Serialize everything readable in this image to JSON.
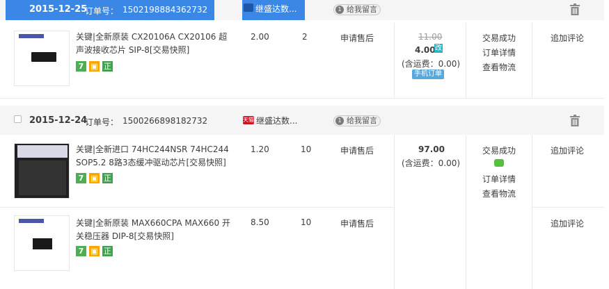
{
  "orders": [
    {
      "date": "2015-12-25",
      "order_label": "订单号：",
      "order_no": "1502198884362732",
      "shop": "继盛达数...",
      "message_btn": "给我留言",
      "items": [
        {
          "title": "关键|全新原装 CX20106A CX20106 超声波接收芯片 SIP-8[交易快照]",
          "unit_price": "2.00",
          "qty": "2",
          "after_sale": "申请售后",
          "review": "追加评论"
        }
      ],
      "original_total": "11.00",
      "total": "4.00",
      "changed_tag": "改",
      "shipping": "(含运费：0.00)",
      "mobile_tag": "手机订单",
      "status": "交易成功",
      "detail": "订单详情",
      "logistics": "查看物流"
    },
    {
      "date": "2015-12-24",
      "order_label": "订单号：",
      "order_no": "1500266898182732",
      "shop": "继盛达数...",
      "shop_tag": "天猫",
      "message_btn": "给我留言",
      "items": [
        {
          "title": "关键|全新进口 74HC244NSR 74HC244 SOP5.2 8路3态缓冲驱动芯片[交易快照]",
          "unit_price": "1.20",
          "qty": "10",
          "after_sale": "申请售后",
          "review": "追加评论"
        },
        {
          "title": "关键|全新原装 MAX660CPA MAX660 开关稳压器 DIP-8[交易快照]",
          "unit_price": "8.50",
          "qty": "10",
          "after_sale": "申请售后",
          "review": "追加评论"
        }
      ],
      "total": "97.00",
      "shipping": "(含运费：0.00)",
      "status": "交易成功",
      "detail": "订单详情",
      "logistics": "查看物流"
    }
  ],
  "badges": {
    "seven": "7",
    "zheng": "正"
  },
  "icons": {
    "trash": "trash-icon",
    "message_dot": "1"
  },
  "colors": {
    "accent_blue": "#3a87e6",
    "price_red": "#3c3c3c",
    "badge_green": "#4caf50"
  }
}
